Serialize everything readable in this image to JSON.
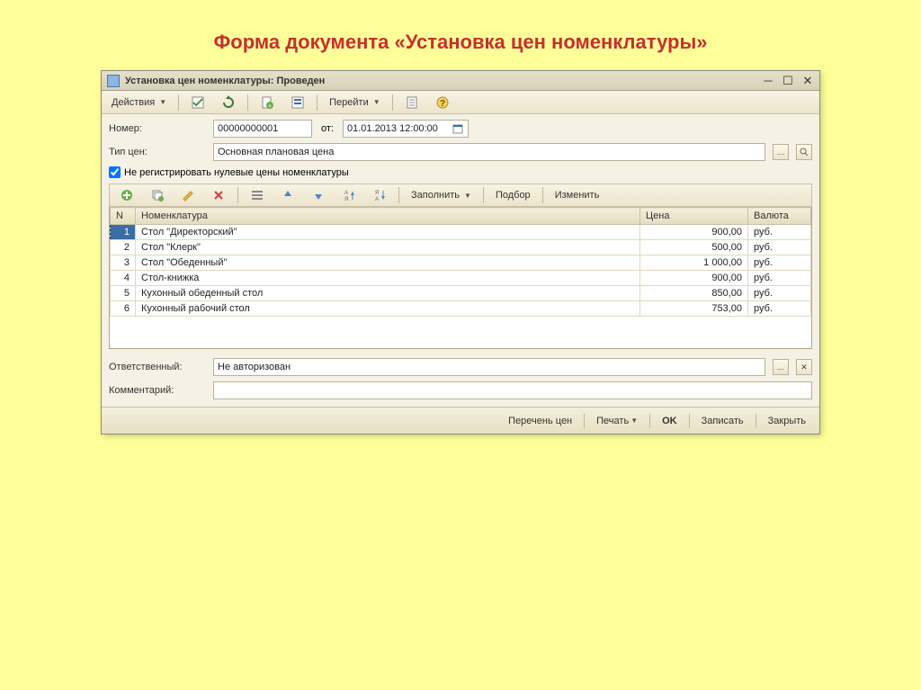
{
  "slide_title": "Форма документа «Установка цен номенклатуры»",
  "window": {
    "title": "Установка цен номенклатуры: Проведен"
  },
  "toolbar1": {
    "actions": "Действия",
    "goto": "Перейти"
  },
  "fields": {
    "number_label": "Номер:",
    "number_value": "00000000001",
    "from_label": "от:",
    "date_value": "01.01.2013 12:00:00",
    "price_type_label": "Тип цен:",
    "price_type_value": "Основная плановая цена",
    "suppress_zero_label": "Не регистрировать нулевые цены номенклатуры"
  },
  "toolbar2": {
    "fill": "Заполнить",
    "pick": "Подбор",
    "change": "Изменить"
  },
  "grid": {
    "headers": {
      "n": "N",
      "name": "Номенклатура",
      "price": "Цена",
      "currency": "Валюта"
    },
    "rows": [
      {
        "n": "1",
        "name": "Стол \"Директорский\"",
        "price": "900,00",
        "currency": "руб."
      },
      {
        "n": "2",
        "name": "Стол \"Клерк\"",
        "price": "500,00",
        "currency": "руб."
      },
      {
        "n": "3",
        "name": "Стол \"Обеденный\"",
        "price": "1 000,00",
        "currency": "руб."
      },
      {
        "n": "4",
        "name": "Стол-книжка",
        "price": "900,00",
        "currency": "руб."
      },
      {
        "n": "5",
        "name": "Кухонный обеденный стол",
        "price": "850,00",
        "currency": "руб."
      },
      {
        "n": "6",
        "name": "Кухонный рабочий стол",
        "price": "753,00",
        "currency": "руб."
      }
    ]
  },
  "footer_fields": {
    "responsible_label": "Ответственный:",
    "responsible_value": "Не авторизован",
    "comment_label": "Комментарий:",
    "comment_value": ""
  },
  "bottombar": {
    "price_list": "Перечень цен",
    "print": "Печать",
    "ok": "OK",
    "save": "Записать",
    "close": "Закрыть"
  }
}
